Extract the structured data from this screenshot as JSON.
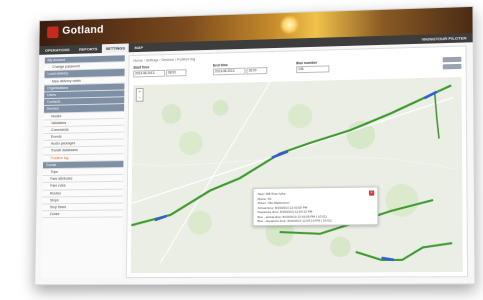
{
  "app": {
    "logo_text": "Gotland"
  },
  "nav": {
    "items": [
      "OPERATIONS",
      "REPORTS",
      "SETTINGS",
      "MAP"
    ],
    "active_index": 2,
    "right_text": "VIKINGTOUR PILOTEN"
  },
  "sidebar": {
    "rows": [
      {
        "label": "My account",
        "type": "head"
      },
      {
        "label": "Change password",
        "type": "sub"
      },
      {
        "label": "Local delivery",
        "type": "head"
      },
      {
        "label": "New delivery notes",
        "type": "sub"
      },
      {
        "label": "Organisations",
        "type": "head"
      },
      {
        "label": "Users",
        "type": "head"
      },
      {
        "label": "Contacts",
        "type": "head"
      },
      {
        "label": "Devices",
        "type": "head"
      },
      {
        "label": "Nodes",
        "type": "sub"
      },
      {
        "label": "Validators",
        "type": "sub"
      },
      {
        "label": "Commands",
        "type": "sub"
      },
      {
        "label": "Events",
        "type": "sub"
      },
      {
        "label": "Audio packages",
        "type": "sub"
      },
      {
        "label": "Transit databases",
        "type": "sub"
      },
      {
        "label": "Position log",
        "type": "sub",
        "selected": true
      },
      {
        "label": "Transit",
        "type": "head"
      },
      {
        "label": "Trips",
        "type": "sub"
      },
      {
        "label": "Fare attributes",
        "type": "sub"
      },
      {
        "label": "Fare rules",
        "type": "sub"
      },
      {
        "label": "Routes",
        "type": "sub"
      },
      {
        "label": "Stops",
        "type": "sub"
      },
      {
        "label": "Stop times",
        "type": "sub"
      },
      {
        "label": "Zones",
        "type": "sub"
      }
    ]
  },
  "breadcrumb": "Home › Settings › Devices › Position log",
  "filters": {
    "start_label": "Start time",
    "start_date": "2013-08-2013",
    "start_time": "08:00",
    "end_label": "End time",
    "end_date": "2013-08-2013",
    "end_time": "18:00",
    "bus_label": "Bus number",
    "bus_value": "105"
  },
  "popup": {
    "lines": [
      "Stop: Mill Rute fyrka",
      "Route: 45",
      "Driver: Olle Mattersson",
      "Arrival time: 8/19/2013 12:03:09 PM",
      "Departure time: 8/19/2013 12:04:10 PM",
      "Bus - arrival time: 8/19/2013 12:03:09 PM ( 10:01)",
      "Bus - departure time: 8/19/2013 12:04:10 PM ( 10:01)"
    ]
  },
  "colors": {
    "route": "#3f9a2f",
    "highlight": "#2f5fd0",
    "head_row": "#7f8fa6"
  }
}
